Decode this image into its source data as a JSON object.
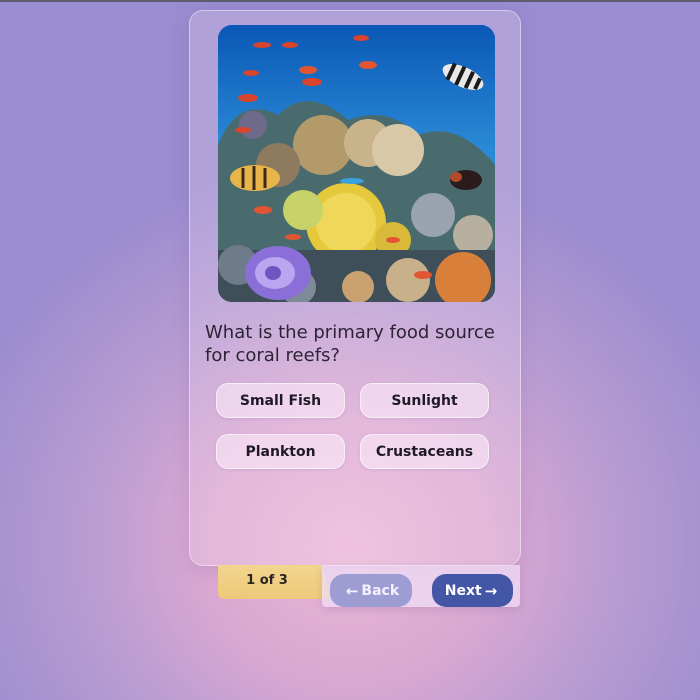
{
  "quiz": {
    "image_alt": "coral reef with tropical fish",
    "question": "What is the primary food source for coral reefs?",
    "answers": [
      "Small Fish",
      "Sunlight",
      "Plankton",
      "Crustaceans"
    ]
  },
  "progress": {
    "label": "1 of 3",
    "current": 1,
    "total": 3
  },
  "nav": {
    "back_label": "Back",
    "next_label": "Next",
    "back_icon": "arrow-left-icon",
    "next_icon": "arrow-right-icon"
  },
  "colors": {
    "next_button": "#4457a6",
    "back_button": "#9e9dd3",
    "counter_tab": "#f0cf85"
  }
}
